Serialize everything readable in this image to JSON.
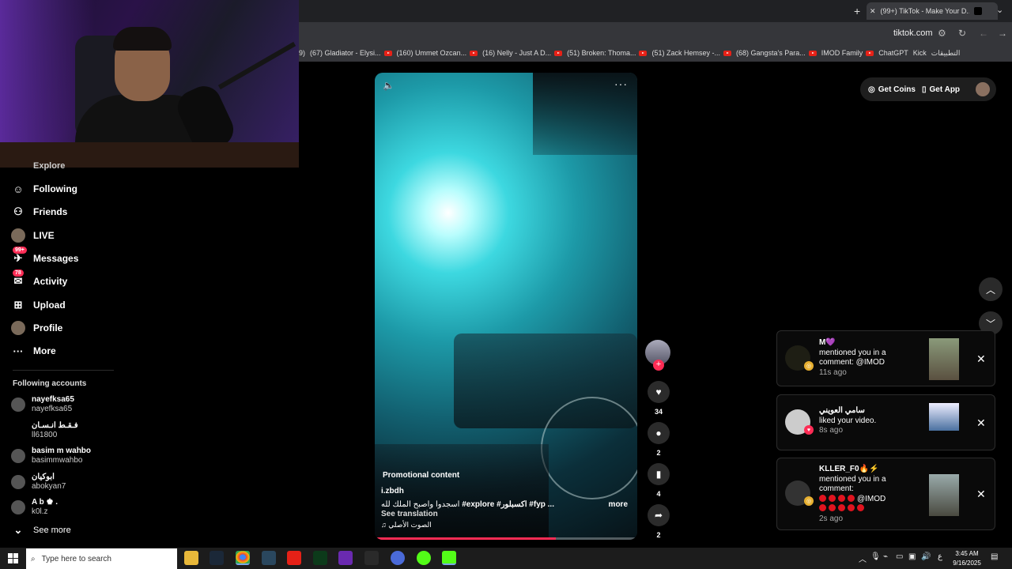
{
  "browser": {
    "tab_title": "(99+) TikTok - Make Your D...",
    "url": "tiktok.com",
    "bookmarks": [
      {
        "label": "9)",
        "yt": false
      },
      {
        "label": "(67) Gladiator - Elysi...",
        "yt": true
      },
      {
        "label": "(160) Ummet Ozcan...",
        "yt": true
      },
      {
        "label": "(16) Nelly - Just A D...",
        "yt": true
      },
      {
        "label": "(51) Broken: Thoma...",
        "yt": true
      },
      {
        "label": "(51) Zack Hemsey -...",
        "yt": true
      },
      {
        "label": "(68) Gangsta's Para...",
        "yt": true
      },
      {
        "label": "IMOD Family",
        "yt": true
      },
      {
        "label": "ChatGPT",
        "yt": false
      },
      {
        "label": "Kick",
        "yt": false
      },
      {
        "label": "التطبيقات",
        "yt": false
      }
    ]
  },
  "sidebar": {
    "partial_item": "Explore",
    "items": [
      {
        "label": "Following",
        "icon": "following-icon",
        "badge": ""
      },
      {
        "label": "Friends",
        "icon": "friends-icon",
        "badge": ""
      },
      {
        "label": "LIVE",
        "icon": "live-icon",
        "badge": ""
      },
      {
        "label": "Messages",
        "icon": "messages-icon",
        "badge": "99+"
      },
      {
        "label": "Activity",
        "icon": "activity-icon",
        "badge": "78"
      },
      {
        "label": "Upload",
        "icon": "upload-icon",
        "badge": ""
      },
      {
        "label": "Profile",
        "icon": "profile-icon",
        "badge": ""
      },
      {
        "label": "More",
        "icon": "more-icon",
        "badge": ""
      }
    ],
    "following_title": "Following accounts",
    "accounts": [
      {
        "name": "nayefksa65",
        "handle": "nayefksa65"
      },
      {
        "name": "ﻓـﻘـﻂ انـسـان",
        "handle": "ll61800"
      },
      {
        "name": "basim m wahbo",
        "handle": "basimmwahbo"
      },
      {
        "name": "ابوكيان",
        "handle": "abokyan7"
      },
      {
        "name": "A b ♚ .",
        "handle": "k0l.z"
      }
    ],
    "see_more": "See more"
  },
  "video": {
    "promo": "Promotional content",
    "username": "i.zbdh",
    "description_ar": "اسجدوا واصبح الملك لله",
    "tags": [
      "#explore",
      "#اكسبلور",
      "#fyp",
      "..."
    ],
    "more": "more",
    "see_translation": "See translation",
    "sound": "الصوت الأصلي",
    "progress": 0.69
  },
  "actions": {
    "likes": "34",
    "comments": "2",
    "saves": "4",
    "shares": "2"
  },
  "topbar": {
    "get_coins": "Get Coins",
    "get_app": "Get App"
  },
  "notifications": [
    {
      "user": "M💜",
      "line1": "mentioned you in a",
      "line2": "comment: @IMOD",
      "line3": "",
      "time": "11s ago"
    },
    {
      "user": "سامي العويني",
      "line1": "liked your video.",
      "line2": "",
      "line3": "",
      "time": "8s ago"
    },
    {
      "user": "KLLER_F0🔥⚡",
      "line1": "mentioned you in a",
      "line2": "comment:",
      "line3": "@IMOD",
      "time": "2s ago"
    }
  ],
  "taskbar": {
    "search_placeholder": "Type here to search",
    "time": "3:45 AM",
    "date": "9/16/2025",
    "lang": "ع"
  }
}
